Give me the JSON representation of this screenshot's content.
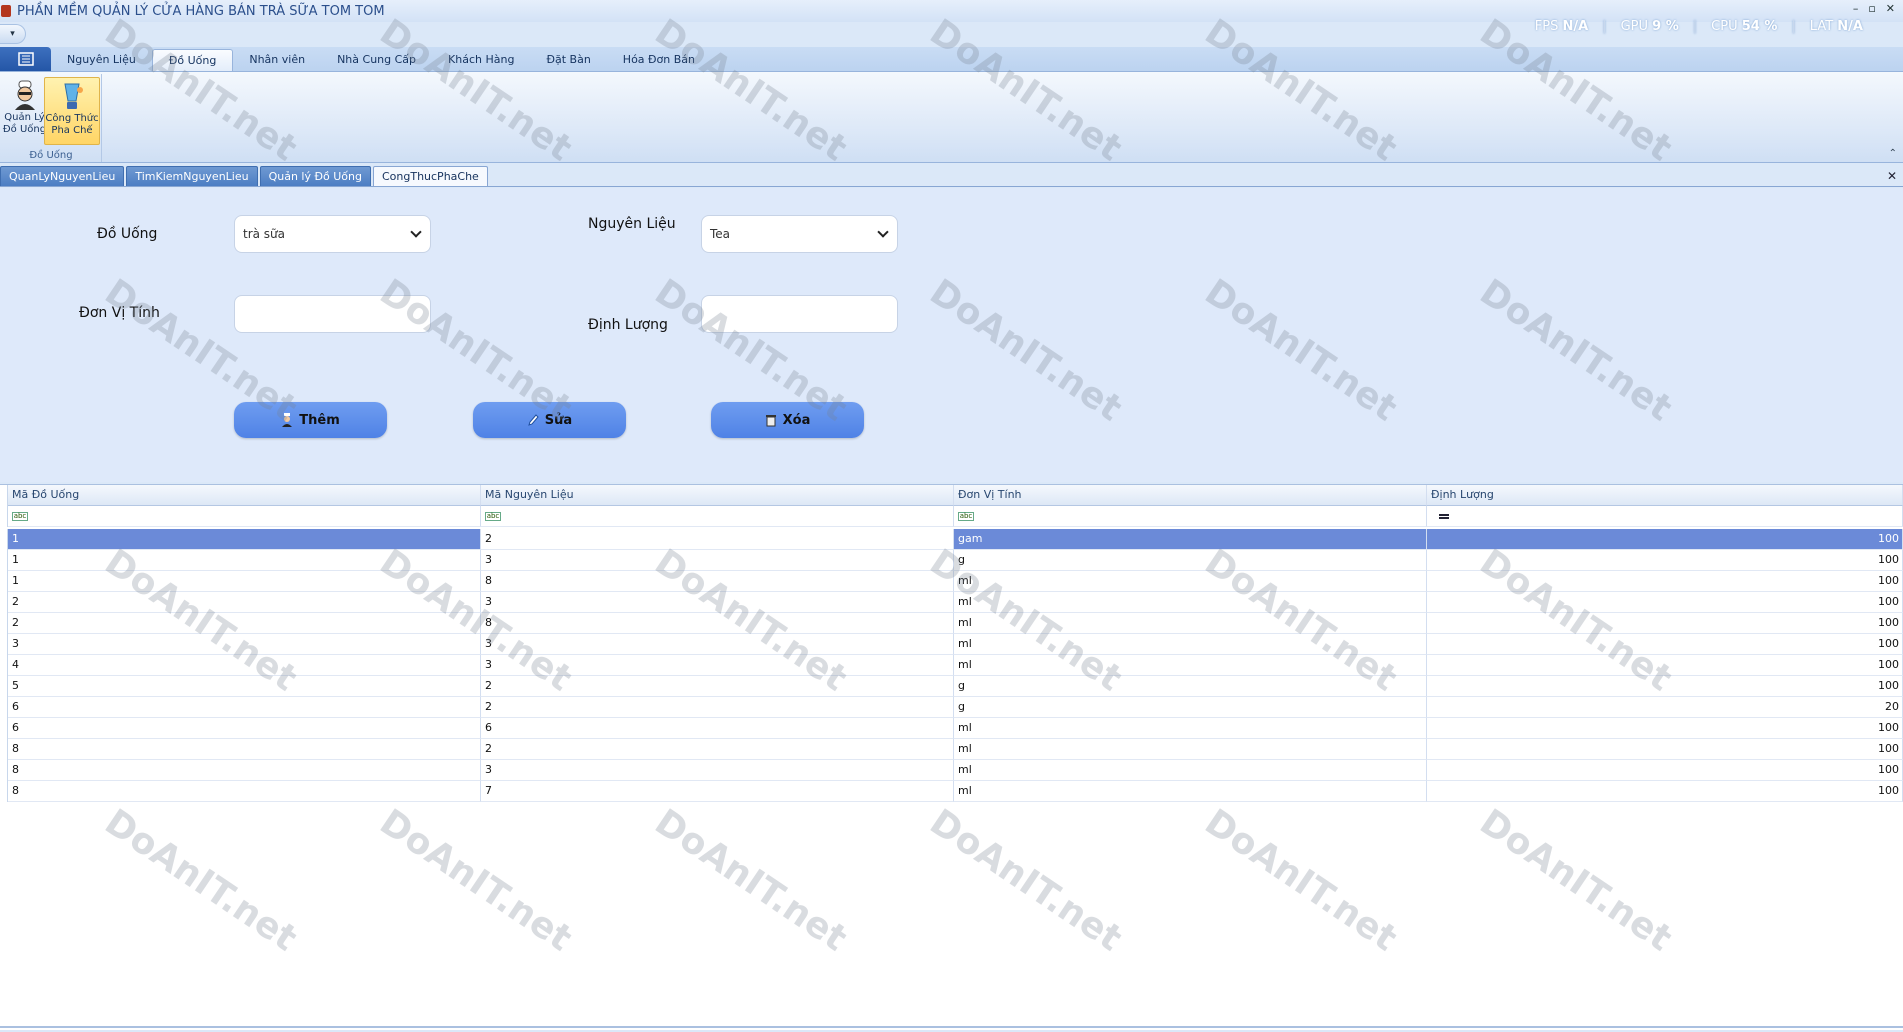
{
  "window": {
    "title": "PHẦN MỀM QUẢN LÝ CỬA HÀNG BÁN TRÀ SỮA TOM TOM",
    "min": "–",
    "max": "▫",
    "close": "✕"
  },
  "perf": {
    "fps_label": "FPS",
    "fps_value": "N/A",
    "gpu_label": "GPU",
    "gpu_value": "9 %",
    "cpu_label": "CPU",
    "cpu_value": "54 %",
    "lat_label": "LAT",
    "lat_value": "N/A",
    "color": "#ffffff"
  },
  "ribbon": {
    "tabs": [
      "Nguyên Liệu",
      "Đồ Uống",
      "Nhân viên",
      "Nhà Cung Cấp",
      "Khách Hàng",
      "Đặt Bàn",
      "Hóa Đơn Bán"
    ],
    "active_tab": "Đồ Uống",
    "group": {
      "label": "Đồ Uống",
      "buttons": [
        {
          "line1": "Quản Lý",
          "line2": "Đồ Uống",
          "icon": "chef-icon"
        },
        {
          "line1": "Công Thức",
          "line2": "Pha Chế",
          "icon": "blender-icon"
        }
      ]
    }
  },
  "doc_tabs": [
    "QuanLyNguyenLieu",
    "TimKiemNguyenLieu",
    "Quản lý Đồ Uống",
    "CongThucPhaChe"
  ],
  "form": {
    "do_uong_label": "Đồ Uống",
    "do_uong_value": "trà sữa",
    "nguyen_lieu_label": "Nguyên Liệu",
    "nguyen_lieu_value": "Tea",
    "don_vi_tinh_label": "Đơn Vị Tính",
    "don_vi_tinh_value": "",
    "dinh_luong_label": "Định Lượng",
    "dinh_luong_value": "",
    "btn_them": "Thêm",
    "btn_sua": "Sửa",
    "btn_xoa": "Xóa",
    "button_color": "#5b8ce9"
  },
  "grid": {
    "columns": [
      "Mã Đồ Uống",
      "Mã Nguyên Liệu",
      "Đơn Vị Tính",
      "Định Lượng"
    ],
    "selection_color": "#6b8ad8",
    "rows": [
      [
        "1",
        "2",
        "gam",
        "100"
      ],
      [
        "1",
        "3",
        "g",
        "100"
      ],
      [
        "1",
        "8",
        "ml",
        "100"
      ],
      [
        "2",
        "3",
        "ml",
        "100"
      ],
      [
        "2",
        "8",
        "ml",
        "100"
      ],
      [
        "3",
        "3",
        "ml",
        "100"
      ],
      [
        "4",
        "3",
        "ml",
        "100"
      ],
      [
        "5",
        "2",
        "g",
        "100"
      ],
      [
        "6",
        "2",
        "g",
        "20"
      ],
      [
        "6",
        "6",
        "ml",
        "100"
      ],
      [
        "8",
        "2",
        "ml",
        "100"
      ],
      [
        "8",
        "3",
        "ml",
        "100"
      ],
      [
        "8",
        "7",
        "ml",
        "100"
      ]
    ]
  },
  "watermark": "DoAnIT.net"
}
